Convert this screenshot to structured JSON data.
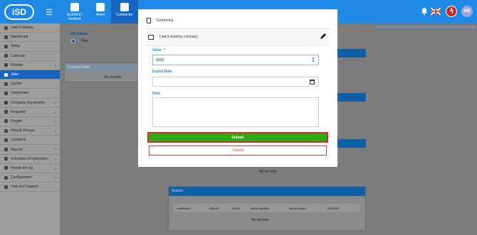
{
  "app": {
    "logo": "iSD"
  },
  "topbar": {
    "tiles": [
      {
        "label": "Accident / Incident"
      },
      {
        "label": "Asset"
      },
      {
        "label": "Contractor"
      }
    ]
  },
  "user": {
    "initials": "HD"
  },
  "sidebar": {
    "items": [
      {
        "label": "Liam's training",
        "chevron": false
      },
      {
        "label": "Dashboard",
        "chevron": false
      },
      {
        "label": "Today",
        "chevron": false
      },
      {
        "label": "Calendar",
        "chevron": false
      },
      {
        "label": "Permits",
        "chevron": true
      },
      {
        "label": "Jobs",
        "chevron": false,
        "active": true
      },
      {
        "label": "Quotes",
        "chevron": false
      },
      {
        "label": "Companies",
        "chevron": false
      },
      {
        "label": "Company Documents",
        "chevron": true
      },
      {
        "label": "Requests",
        "chevron": true
      },
      {
        "label": "People",
        "chevron": true
      },
      {
        "label": "People Groups",
        "chevron": true
      },
      {
        "label": "Locations",
        "chevron": false
      },
      {
        "label": "Reports",
        "chevron": true
      },
      {
        "label": "Inductions & Inductions",
        "chevron": true
      },
      {
        "label": "Permit Set Up",
        "chevron": true
      },
      {
        "label": "Configuration",
        "chevron": true
      },
      {
        "label": "Help and Support",
        "chevron": false
      }
    ]
  },
  "background": {
    "job_status_label": "Job Status",
    "job_status_value": "New",
    "custom_fields_header": "Custom Fields",
    "no_records": "No records",
    "quotes_header": "Quotes",
    "quotes_columns": [
      "COMPANY",
      "VALUE",
      "NOTE",
      "DATE ADDED",
      "VALID UNTIL",
      "STATUS"
    ]
  },
  "modal": {
    "document_name": "Gardening",
    "company_name": "Liam's training company",
    "value_label": "Value",
    "value_required_mark": "*",
    "value": "4000",
    "expiry_label": "Expiry Date",
    "expiry_value": "",
    "note_label": "Note",
    "note_value": "",
    "submit_label": "Submit",
    "cancel_label": "Cancel"
  },
  "colors": {
    "brand_blue": "#1e88e5",
    "submit_green": "#2eaa14",
    "highlight_red": "#d32f2f",
    "cancel_red": "#e53935"
  }
}
